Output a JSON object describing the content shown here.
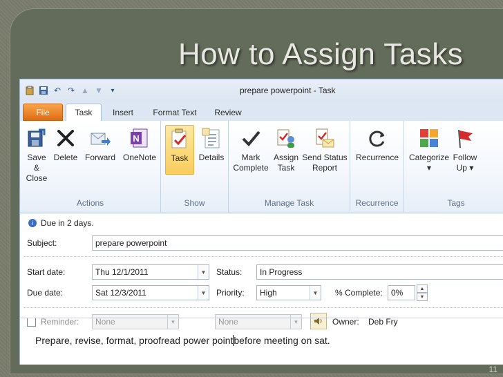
{
  "slide": {
    "title": "How to Assign Tasks",
    "page_number": "11"
  },
  "window": {
    "title": "prepare powerpoint - Task"
  },
  "tabs": [
    "File",
    "Task",
    "Insert",
    "Format Text",
    "Review"
  ],
  "ribbon": {
    "actions": {
      "label": "Actions",
      "save_close": "Save &\nClose",
      "delete": "Delete",
      "forward": "Forward",
      "onenote": "OneNote"
    },
    "show": {
      "label": "Show",
      "task": "Task",
      "details": "Details"
    },
    "manage_task": {
      "label": "Manage Task",
      "mark_complete": "Mark\nComplete",
      "assign_task": "Assign\nTask",
      "send_status_report": "Send Status\nReport"
    },
    "recurrence": {
      "label": "Recurrence",
      "recurrence": "Recurrence"
    },
    "tags": {
      "label": "Tags",
      "categorize": "Categorize\n▾",
      "follow_up": "Follow\nUp ▾"
    }
  },
  "info": {
    "text": "Due in 2 days."
  },
  "form": {
    "subject_label": "Subject:",
    "subject_value": "prepare powerpoint",
    "start_date_label": "Start date:",
    "start_date_value": "Thu 12/1/2011",
    "due_date_label": "Due date:",
    "due_date_value": "Sat 12/3/2011",
    "status_label": "Status:",
    "status_value": "In Progress",
    "priority_label": "Priority:",
    "priority_value": "High",
    "percent_label": "% Complete:",
    "percent_value": "0%",
    "reminder_label": "Reminder:",
    "reminder_date": "None",
    "reminder_time": "None",
    "owner_label": "Owner:",
    "owner_value": "Deb Fry"
  },
  "body": {
    "text_before_cursor": "Prepare, revise, format, proofread power point",
    "text_after_cursor": "before meeting on sat."
  }
}
